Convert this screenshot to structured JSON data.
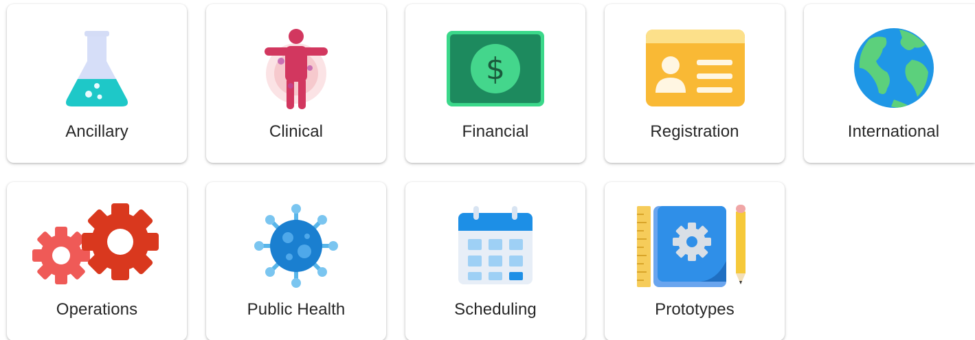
{
  "tiles": [
    {
      "label": "Ancillary",
      "icon": "flask-icon"
    },
    {
      "label": "Clinical",
      "icon": "human-body-icon"
    },
    {
      "label": "Financial",
      "icon": "dollar-bill-icon"
    },
    {
      "label": "Registration",
      "icon": "id-card-icon"
    },
    {
      "label": "International",
      "icon": "globe-icon"
    },
    {
      "label": "Operations",
      "icon": "gears-icon"
    },
    {
      "label": "Public Health",
      "icon": "virus-icon"
    },
    {
      "label": "Scheduling",
      "icon": "calendar-icon"
    },
    {
      "label": "Prototypes",
      "icon": "blueprint-icon"
    }
  ],
  "colors": {
    "tile_background": "#ffffff",
    "label_text": "#262626"
  }
}
